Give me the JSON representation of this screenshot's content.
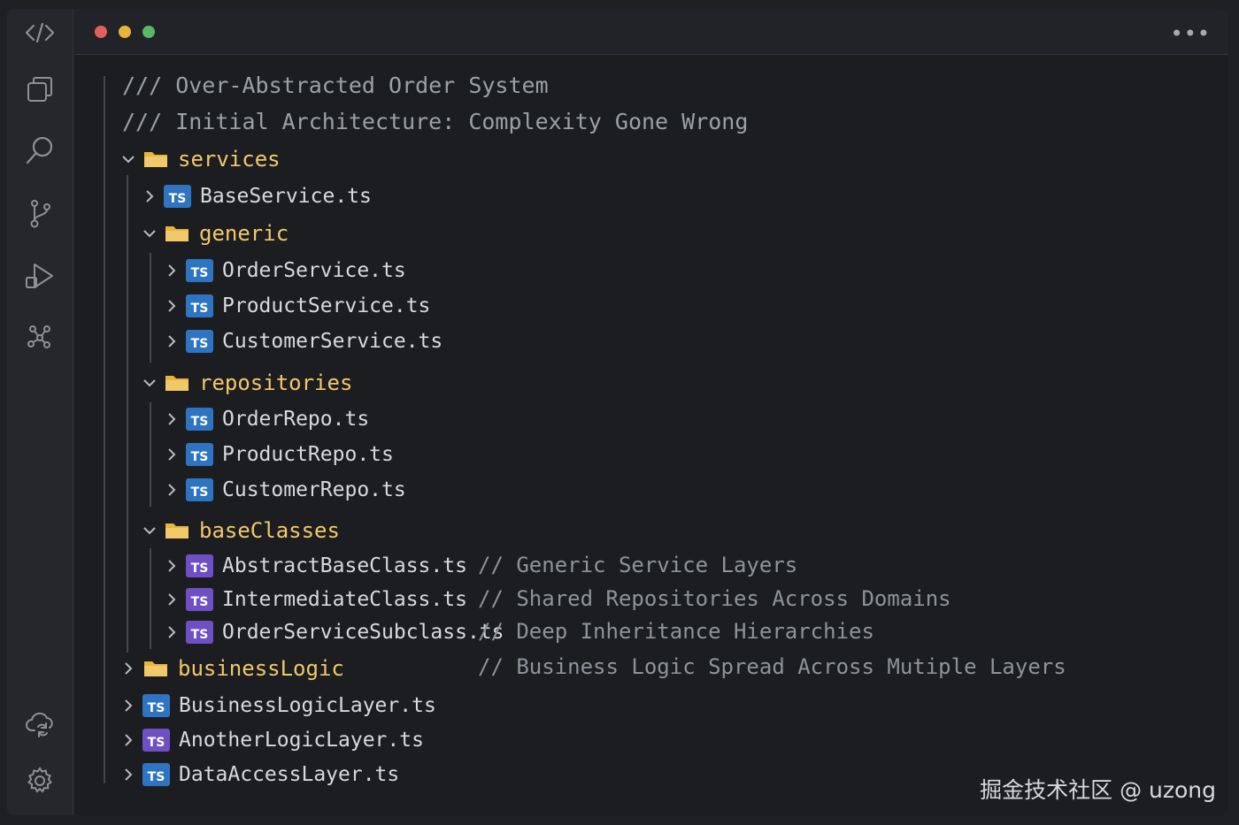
{
  "window": {
    "more_icon": "more-horizontal-icon"
  },
  "activity_bar": {
    "items": [
      {
        "name": "code",
        "icon": "code-brackets-icon"
      },
      {
        "name": "explorer",
        "icon": "copy-files-icon"
      },
      {
        "name": "search",
        "icon": "search-icon"
      },
      {
        "name": "source-control",
        "icon": "git-branch-icon"
      },
      {
        "name": "run-debug",
        "icon": "play-debug-icon"
      },
      {
        "name": "extensions",
        "icon": "extensions-icon"
      },
      {
        "name": "remote",
        "icon": "cloud-sync-icon"
      },
      {
        "name": "settings",
        "icon": "gear-icon"
      }
    ]
  },
  "header_comments": {
    "line1": "/// Over-Abstracted Order System",
    "line2": "/// Initial Architecture: Complexity Gone Wrong"
  },
  "tree": {
    "services": {
      "label": "services",
      "expanded": true
    },
    "base_service": {
      "label": "BaseService.ts"
    },
    "generic": {
      "label": "generic",
      "expanded": true
    },
    "order_service": {
      "label": "OrderService.ts"
    },
    "product_service": {
      "label": "ProductService.ts"
    },
    "customer_service": {
      "label": "CustomerService.ts"
    },
    "repositories": {
      "label": "repositories",
      "expanded": true
    },
    "order_repo": {
      "label": "OrderRepo.ts"
    },
    "product_repo": {
      "label": "ProductRepo.ts"
    },
    "customer_repo": {
      "label": "CustomerRepo.ts"
    },
    "base_classes": {
      "label": "baseClasses",
      "expanded": true
    },
    "abstract_base": {
      "label": "AbstractBaseClass.ts"
    },
    "intermediate": {
      "label": "IntermediateClass.ts"
    },
    "order_subclass": {
      "label": "OrderServiceSubclass.ts"
    },
    "business_logic": {
      "label": "businessLogic",
      "expanded": false
    },
    "business_logic_layer": {
      "label": "BusinessLogicLayer.ts"
    },
    "another_logic_layer": {
      "label": "AnotherLogicLayer.ts"
    },
    "data_access_layer": {
      "label": "DataAccessLayer.ts"
    }
  },
  "inline_comments": {
    "c1": "// Generic Service Layers",
    "c2": "// Shared Repositories Across Domains",
    "c3": "// Deep Inheritance Hierarchies",
    "c4": "// Business Logic Spread Across Mutiple Layers"
  },
  "file_badge": "TS",
  "colors": {
    "folder": "#f1c86a",
    "ts_blue": "#2f74c0",
    "ts_purple": "#6e4fc4",
    "comment": "#9aa0a6"
  },
  "watermark": "掘金技术社区 @ uzong"
}
